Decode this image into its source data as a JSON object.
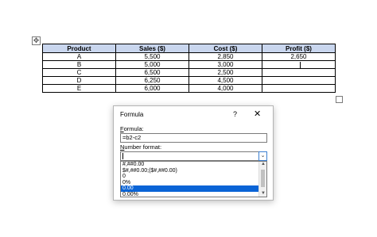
{
  "table": {
    "headers": [
      "Product",
      "Sales ($)",
      "Cost ($)",
      "Profit ($)"
    ],
    "rows": [
      [
        "A",
        "5,500",
        "2,850",
        "2,650"
      ],
      [
        "B",
        "5,000",
        "3,000",
        ""
      ],
      [
        "C",
        "6,500",
        "2,500",
        ""
      ],
      [
        "D",
        "6,250",
        "4,500",
        ""
      ],
      [
        "E",
        "6,000",
        "4,000",
        ""
      ]
    ]
  },
  "dialog": {
    "title": "Formula",
    "help": "?",
    "close": "✕",
    "formula_label_first": "F",
    "formula_label_rest": "ormula:",
    "formula_value": "=b2-c2",
    "number_format_label_first": "N",
    "number_format_label_rest": "umber format:",
    "number_format_value": "",
    "dropdown_icon": "⌄",
    "format_options": [
      "#,##0.00",
      "$#,##0.00;($#,##0.00)",
      "0",
      "0%",
      "0.00",
      "0.00%"
    ],
    "selected_option_index": 4
  },
  "icons": {
    "move_handle": "✥",
    "scroll_up": "▲",
    "scroll_down": "▼"
  }
}
